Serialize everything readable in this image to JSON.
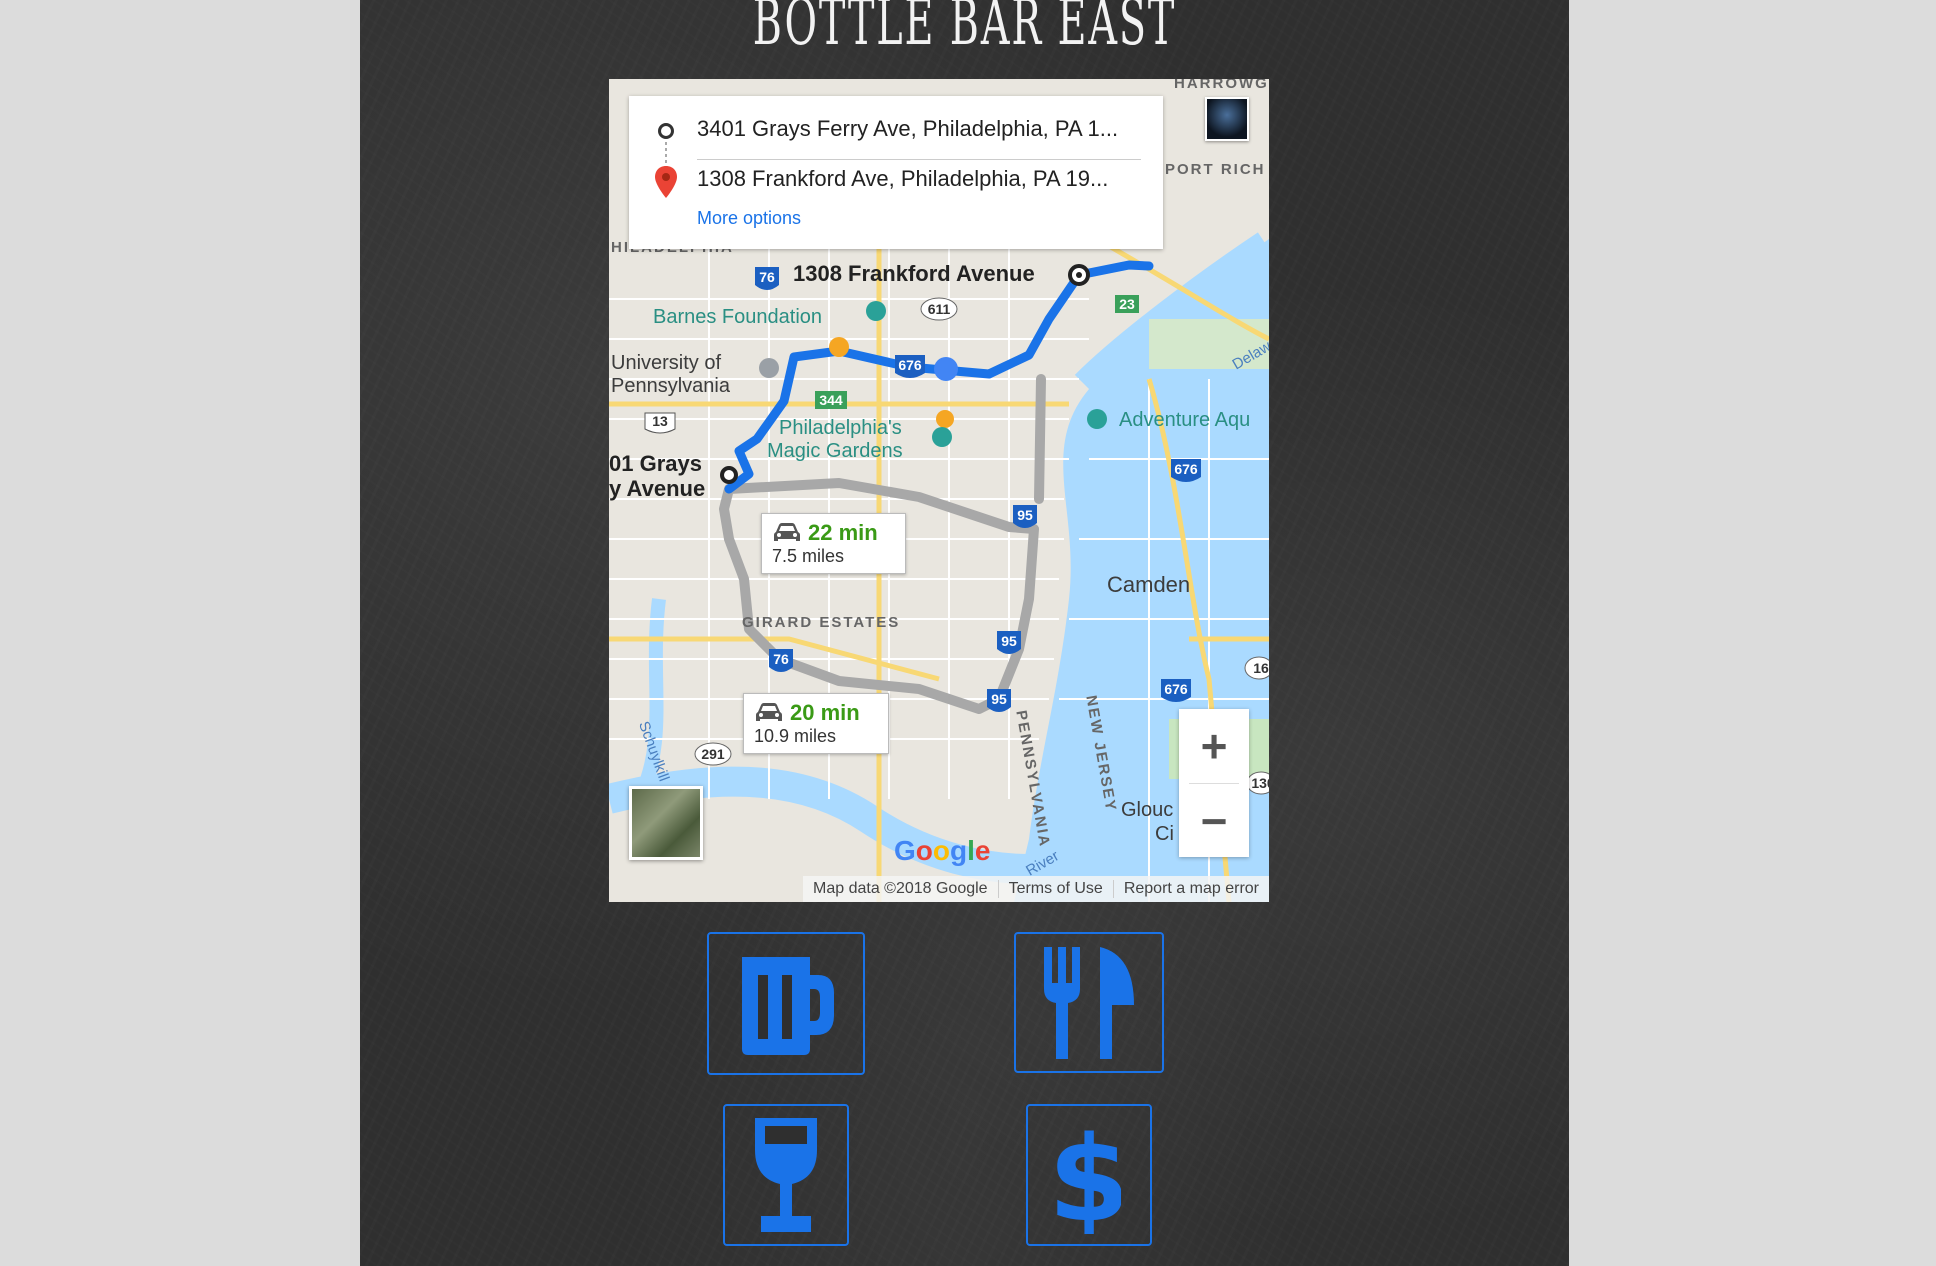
{
  "page": {
    "title": "BOTTLE BAR EAST",
    "accent": "#1a73e8"
  },
  "directions": {
    "origin": "3401 Grays Ferry Ave, Philadelphia, PA 1...",
    "destination": "1308 Frankford Ave, Philadelphia, PA 19...",
    "more_options": "More options"
  },
  "map": {
    "labels": {
      "barnes": "Barnes Foundation",
      "upenn_1": "University of",
      "upenn_2": "Pennsylvania",
      "gardens_1": "Philadelphia's",
      "gardens_2": "Magic Gardens",
      "origin_1": "01 Grays",
      "origin_2": "y Avenue",
      "destination": "1308 Frankford Avenue",
      "adventure": "Adventure Aqu",
      "camden": "Camden",
      "girard": "GIRARD ESTATES",
      "pennsylvania": "PENNSYLVANIA",
      "new_jersey": "NEW JERSEY",
      "harrowg": "HARROWG",
      "port_rich": "PORT RICH",
      "philadelphia_cut": "HILADELPHIA",
      "gloucester_1": "Glouc",
      "gloucester_2": "Ci",
      "schuylkill": "Schuylkill",
      "delaware": "Delaw",
      "river": "River"
    },
    "shields": {
      "i76_top": "76",
      "us611": "611",
      "i676_mid": "676",
      "s344": "344",
      "us13": "13",
      "i95_a": "95",
      "i95_b": "95",
      "i95_c": "95",
      "i76_bottom": "76",
      "s291": "291",
      "i676_right": "676",
      "i676_far": "676",
      "s23": "23",
      "s16": "16",
      "s130": "130"
    },
    "routes": [
      {
        "time": "22 min",
        "distance": "7.5 miles"
      },
      {
        "time": "20 min",
        "distance": "10.9 miles"
      }
    ],
    "zoom_in": "+",
    "zoom_out": "−",
    "google_letters": [
      "G",
      "o",
      "o",
      "g",
      "l",
      "e"
    ],
    "footer": {
      "data": "Map data ©2018 Google",
      "terms": "Terms of Use",
      "report": "Report a map error"
    }
  },
  "menu_icons": [
    {
      "name": "beer-mug-icon"
    },
    {
      "name": "fork-knife-icon"
    },
    {
      "name": "wine-glass-icon"
    },
    {
      "name": "dollar-icon"
    }
  ]
}
